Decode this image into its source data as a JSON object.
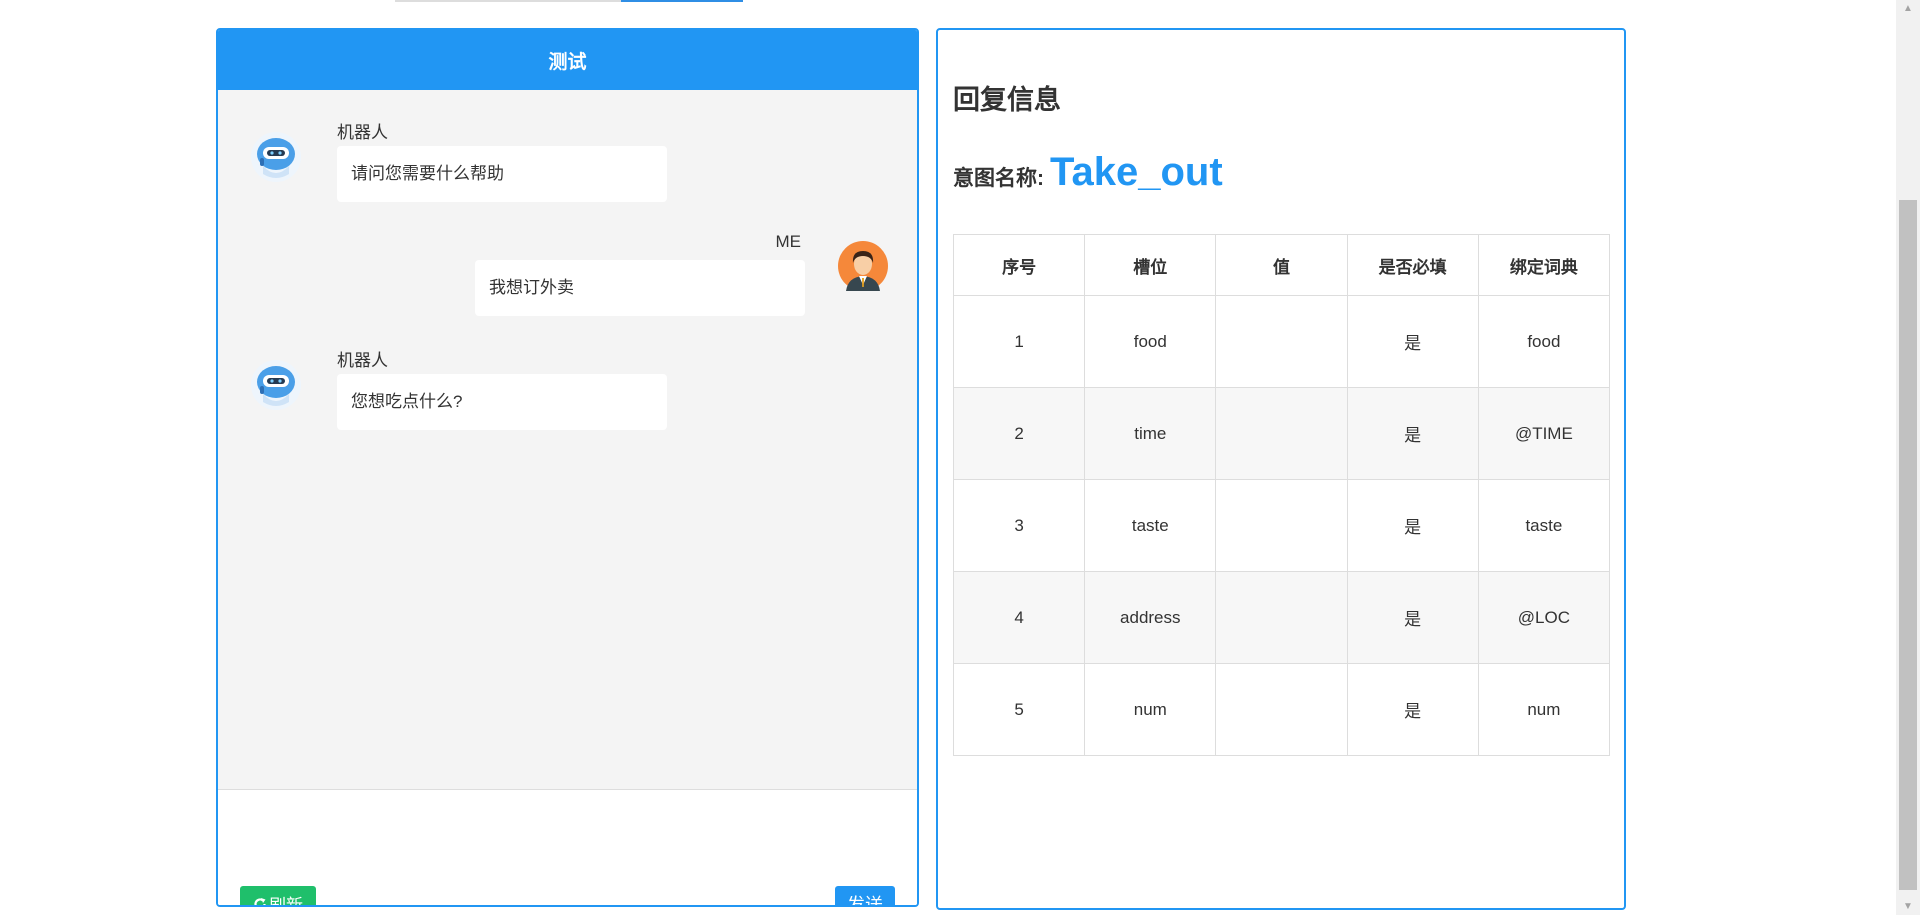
{
  "chat": {
    "title": "测试",
    "messages": [
      {
        "sender": "机器人",
        "text": "请问您需要什么帮助",
        "side": "left",
        "avatar": "robot-icon"
      },
      {
        "sender": "ME",
        "text": "我想订外卖",
        "side": "right",
        "avatar": "user-icon"
      },
      {
        "sender": "机器人",
        "text": "您想吃点什么?",
        "side": "left",
        "avatar": "robot-icon"
      }
    ],
    "refresh_label": "刷新",
    "send_label": "发送",
    "input_value": ""
  },
  "reply": {
    "title": "回复信息",
    "intent_label": "意图名称:",
    "intent_name": "Take_out",
    "columns": [
      "序号",
      "槽位",
      "值",
      "是否必填",
      "绑定词典"
    ],
    "rows": [
      [
        "1",
        "food",
        "",
        "是",
        "food"
      ],
      [
        "2",
        "time",
        "",
        "是",
        "@TIME"
      ],
      [
        "3",
        "taste",
        "",
        "是",
        "taste"
      ],
      [
        "4",
        "address",
        "",
        "是",
        "@LOC"
      ],
      [
        "5",
        "num",
        "",
        "是",
        "num"
      ]
    ]
  },
  "colors": {
    "accent": "#2196f3",
    "refresh": "#1fbf6b"
  }
}
